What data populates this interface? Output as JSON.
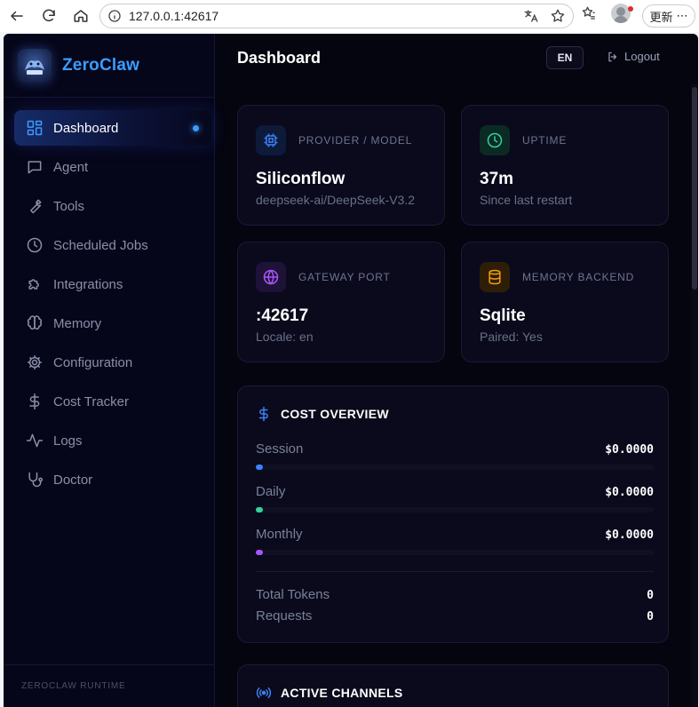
{
  "browser": {
    "url": "127.0.0.1:42617",
    "update_label": "更新",
    "more_label": "⋯"
  },
  "brand": {
    "name": "ZeroClaw",
    "logo_text": "ZEROCLAW"
  },
  "sidebar": {
    "items": [
      {
        "label": "Dashboard",
        "icon": "grid-icon",
        "active": true
      },
      {
        "label": "Agent",
        "icon": "chat-icon"
      },
      {
        "label": "Tools",
        "icon": "wrench-icon"
      },
      {
        "label": "Scheduled Jobs",
        "icon": "clock-icon"
      },
      {
        "label": "Integrations",
        "icon": "puzzle-icon"
      },
      {
        "label": "Memory",
        "icon": "brain-icon"
      },
      {
        "label": "Configuration",
        "icon": "gear-icon"
      },
      {
        "label": "Cost Tracker",
        "icon": "dollar-icon"
      },
      {
        "label": "Logs",
        "icon": "activity-icon"
      },
      {
        "label": "Doctor",
        "icon": "stethoscope-icon"
      }
    ],
    "footer": "ZEROCLAW RUNTIME"
  },
  "header": {
    "title": "Dashboard",
    "lang": "EN",
    "logout": "Logout"
  },
  "stats": {
    "provider": {
      "label": "PROVIDER / MODEL",
      "value": "Siliconflow",
      "sub": "deepseek-ai/DeepSeek-V3.2"
    },
    "uptime": {
      "label": "UPTIME",
      "value": "37m",
      "sub": "Since last restart"
    },
    "gateway": {
      "label": "GATEWAY PORT",
      "value": ":42617",
      "sub": "Locale: en"
    },
    "memory": {
      "label": "MEMORY BACKEND",
      "value": "Sqlite",
      "sub": "Paired: Yes"
    }
  },
  "cost": {
    "title": "COST OVERVIEW",
    "rows": [
      {
        "label": "Session",
        "value": "$0.0000",
        "fraction": 0,
        "color": "#3b82f6"
      },
      {
        "label": "Daily",
        "value": "$0.0000",
        "fraction": 0,
        "color": "#34d399"
      },
      {
        "label": "Monthly",
        "value": "$0.0000",
        "fraction": 0,
        "color": "#a855f7"
      }
    ],
    "totals": [
      {
        "label": "Total Tokens",
        "value": "0"
      },
      {
        "label": "Requests",
        "value": "0"
      }
    ]
  },
  "channels": {
    "title": "ACTIVE CHANNELS"
  },
  "colors": {
    "accent": "#3b9cff",
    "provider_icon": "#3b82f6",
    "uptime_icon": "#34d399",
    "gateway_icon": "#a855f7",
    "memory_icon": "#f59e0b"
  }
}
